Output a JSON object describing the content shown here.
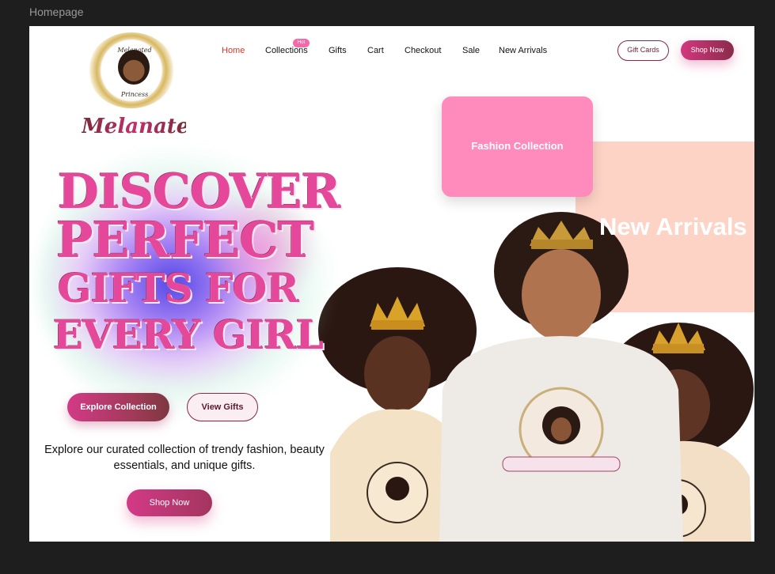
{
  "frame": {
    "label": "Homepage"
  },
  "brand": {
    "name": "Melanated",
    "logo_seal_top": "Melanated",
    "logo_seal_bottom": "Princess"
  },
  "nav": {
    "items": [
      {
        "label": "Home",
        "active": true
      },
      {
        "label": "Collections",
        "badge": "Hot"
      },
      {
        "label": "Gifts"
      },
      {
        "label": "Cart"
      },
      {
        "label": "Checkout"
      },
      {
        "label": "Sale"
      },
      {
        "label": "New Arrivals"
      }
    ],
    "gift_cards_label": "Gift Cards",
    "shop_now_label": "Shop Now"
  },
  "hero": {
    "headline_lines": [
      "DISCOVER",
      "PERFECT",
      "GIFTS FOR",
      "EVERY GIRL"
    ],
    "explore_label": "Explore Collection",
    "view_gifts_label": "View Gifts",
    "tagline": "Explore our curated collection of trendy fashion, beauty essentials, and unique gifts.",
    "shop_now_label": "Shop Now"
  },
  "cards": {
    "fashion_collection": "Fashion Collection",
    "new_arrivals": "New Arrivals"
  },
  "colors": {
    "accent_pink": "#e5479a",
    "active_nav": "#e0342b",
    "card_pink": "#ff8bbd",
    "card_peach": "#fdd3c6",
    "button_dark": "#8e2446"
  }
}
